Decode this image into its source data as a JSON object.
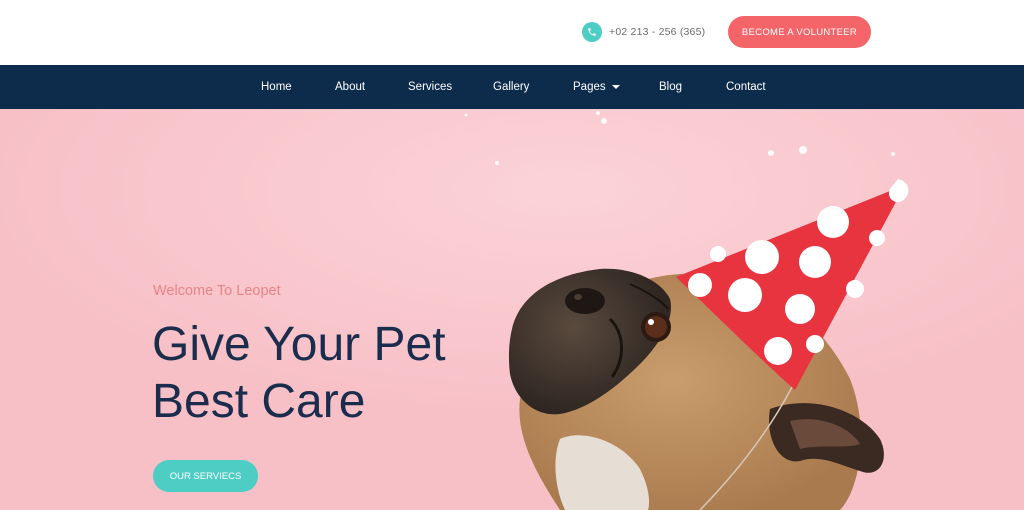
{
  "topbar": {
    "phone_icon": "phone-icon",
    "phone_number": "+02 213 - 256 (365)",
    "volunteer_label": "BECOME A VOLUNTEER"
  },
  "nav": {
    "items": [
      {
        "label": "Home"
      },
      {
        "label": "About"
      },
      {
        "label": "Services"
      },
      {
        "label": "Gallery"
      },
      {
        "label": "Pages",
        "dropdown_icon": "caret-down-icon"
      },
      {
        "label": "Blog"
      },
      {
        "label": "Contact"
      }
    ]
  },
  "hero": {
    "welcome": "Welcome To Leopet",
    "headline_line1": "Give Your Pet",
    "headline_line2": "Best Care",
    "cta_label": "OUR SERVIECS",
    "image": "pug-in-party-hat"
  },
  "colors": {
    "accent_coral": "#f4656a",
    "accent_teal": "#4ecdc4",
    "nav_navy": "#0d2c4c",
    "hero_pink": "#f8c2c9",
    "headline": "#1b2d4d"
  }
}
